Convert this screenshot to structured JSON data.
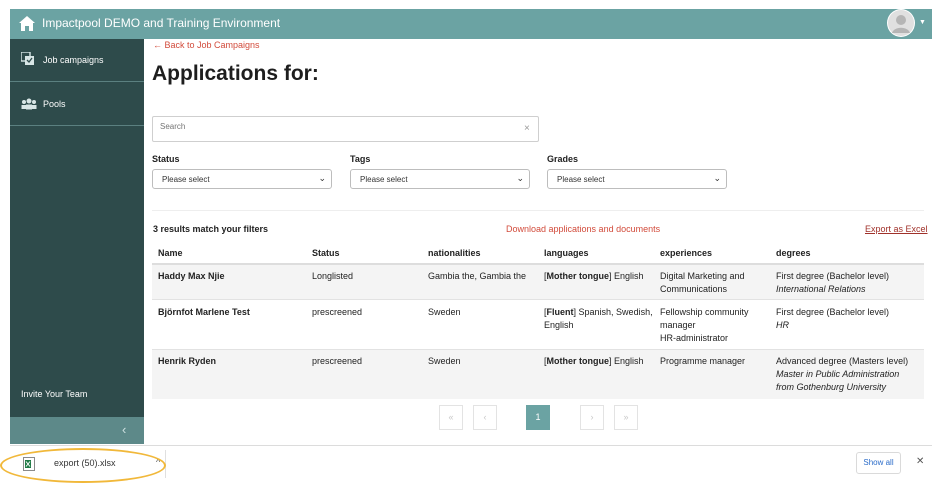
{
  "header": {
    "title": "Impactpool DEMO and Training Environment"
  },
  "sidebar": {
    "items": [
      {
        "label": "Job campaigns",
        "icon": "job-campaigns-icon"
      },
      {
        "label": "Pools",
        "icon": "pools-icon"
      }
    ],
    "invite": "Invite Your Team",
    "collapse": "‹"
  },
  "main": {
    "back_link": "← Back to Job Campaigns",
    "title": "Applications for:",
    "search": {
      "placeholder": "Search",
      "clear": "×"
    },
    "filters": [
      {
        "label": "Status",
        "value": "Please select"
      },
      {
        "label": "Tags",
        "value": "Please select"
      },
      {
        "label": "Grades",
        "value": "Please select"
      }
    ],
    "results_text": "3 results match your filters",
    "download_link": "Download applications and documents",
    "export_link": "Export as Excel",
    "columns": [
      "Name",
      "Status",
      "nationalities",
      "languages",
      "experiences",
      "degrees"
    ],
    "rows": [
      {
        "name": "Haddy Max Njie",
        "status": "Longlisted",
        "nationalities": "Gambia the, Gambia the",
        "lang_level": "Mother tongue",
        "lang_rest": " English",
        "experiences": [
          "Digital Marketing and",
          "Communications"
        ],
        "degree": "First degree (Bachelor level)",
        "degree_subject": "International Relations"
      },
      {
        "name": "Björnfot Marlene Test",
        "status": "prescreened",
        "nationalities": "Sweden",
        "lang_level": "Fluent",
        "lang_rest": " Spanish, Swedish,",
        "lang_line2": "English",
        "experiences": [
          "Fellowship community",
          "manager",
          "HR-administrator"
        ],
        "degree": "First degree (Bachelor level)",
        "degree_subject": "HR"
      },
      {
        "name": "Henrik Ryden",
        "status": "prescreened",
        "nationalities": "Sweden",
        "lang_level": "Mother tongue",
        "lang_rest": " English",
        "experiences": [
          "Programme manager"
        ],
        "degree": "Advanced degree (Masters level)",
        "degree_subject_lines": [
          "Master in Public Administration",
          "from Gothenburg University"
        ]
      }
    ],
    "pagination": {
      "first": "«",
      "prev": "‹",
      "current": "1",
      "next": "›",
      "last": "»"
    }
  },
  "download_bar": {
    "file_name": "export (50).xlsx",
    "caret": "^",
    "show_all": "Show all",
    "close": "✕"
  },
  "colors": {
    "header": "#6ba3a3",
    "sidebar": "#2e4b4b",
    "link_red": "#d24b3b",
    "highlight": "#f1b83a"
  }
}
